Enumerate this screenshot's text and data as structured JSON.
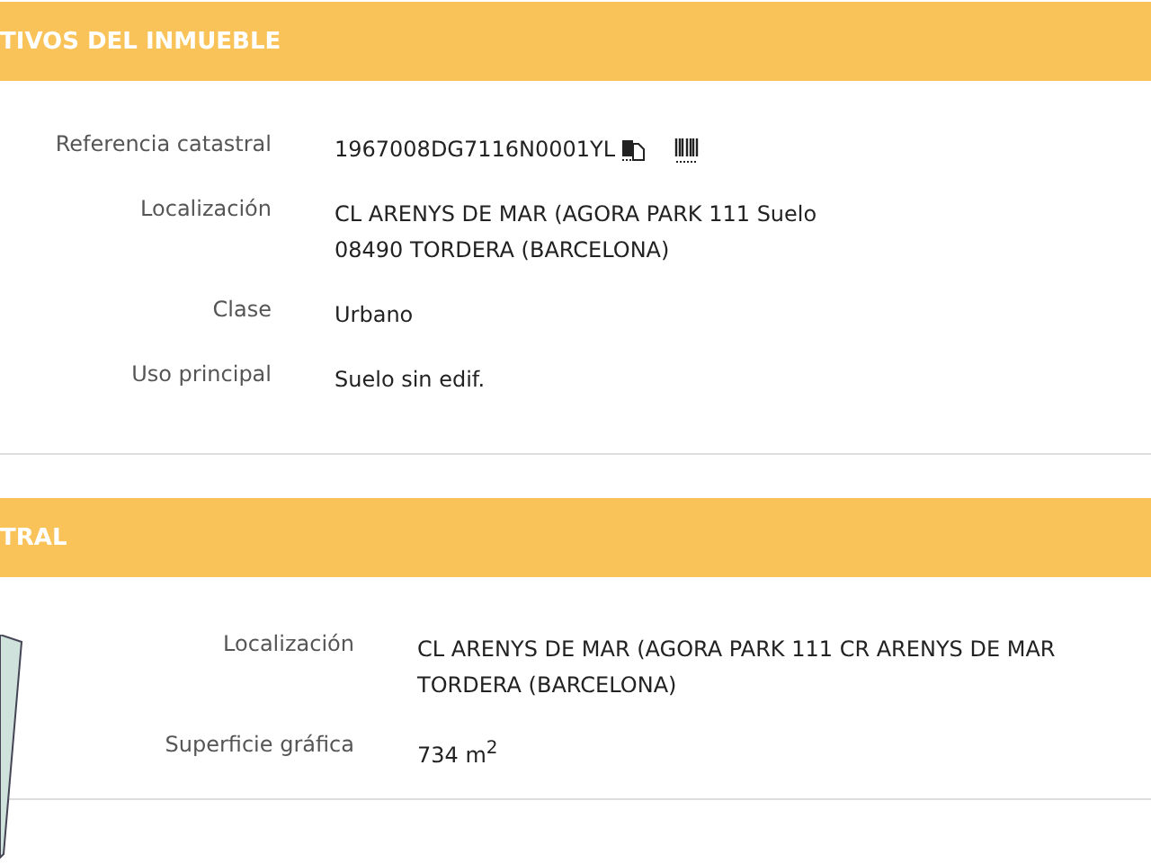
{
  "sections": [
    {
      "title": "TIVOS DEL INMUEBLE",
      "kind": "details",
      "rows": [
        {
          "label": "Referencia catastral",
          "value": [
            "1967008DG7116N0001YL"
          ],
          "icons": true
        },
        {
          "label": "Localización",
          "value": [
            "CL ARENYS DE MAR (AGORA PARK 111 Suelo",
            "08490 TORDERA (BARCELONA)"
          ]
        },
        {
          "label": "Clase",
          "value": [
            "Urbano"
          ]
        },
        {
          "label": "Uso principal",
          "value": [
            "Suelo sin edif."
          ]
        }
      ]
    },
    {
      "title": "TRAL",
      "kind": "parcel",
      "rows": [
        {
          "label": "Localización",
          "value": [
            "CL ARENYS DE MAR (AGORA PARK 111 CR ARENYS DE MAR",
            "TORDERA (BARCELONA)"
          ]
        },
        {
          "label": "Superficie gráfica",
          "value": [
            "734 m$^{2}$"
          ]
        }
      ]
    }
  ]
}
